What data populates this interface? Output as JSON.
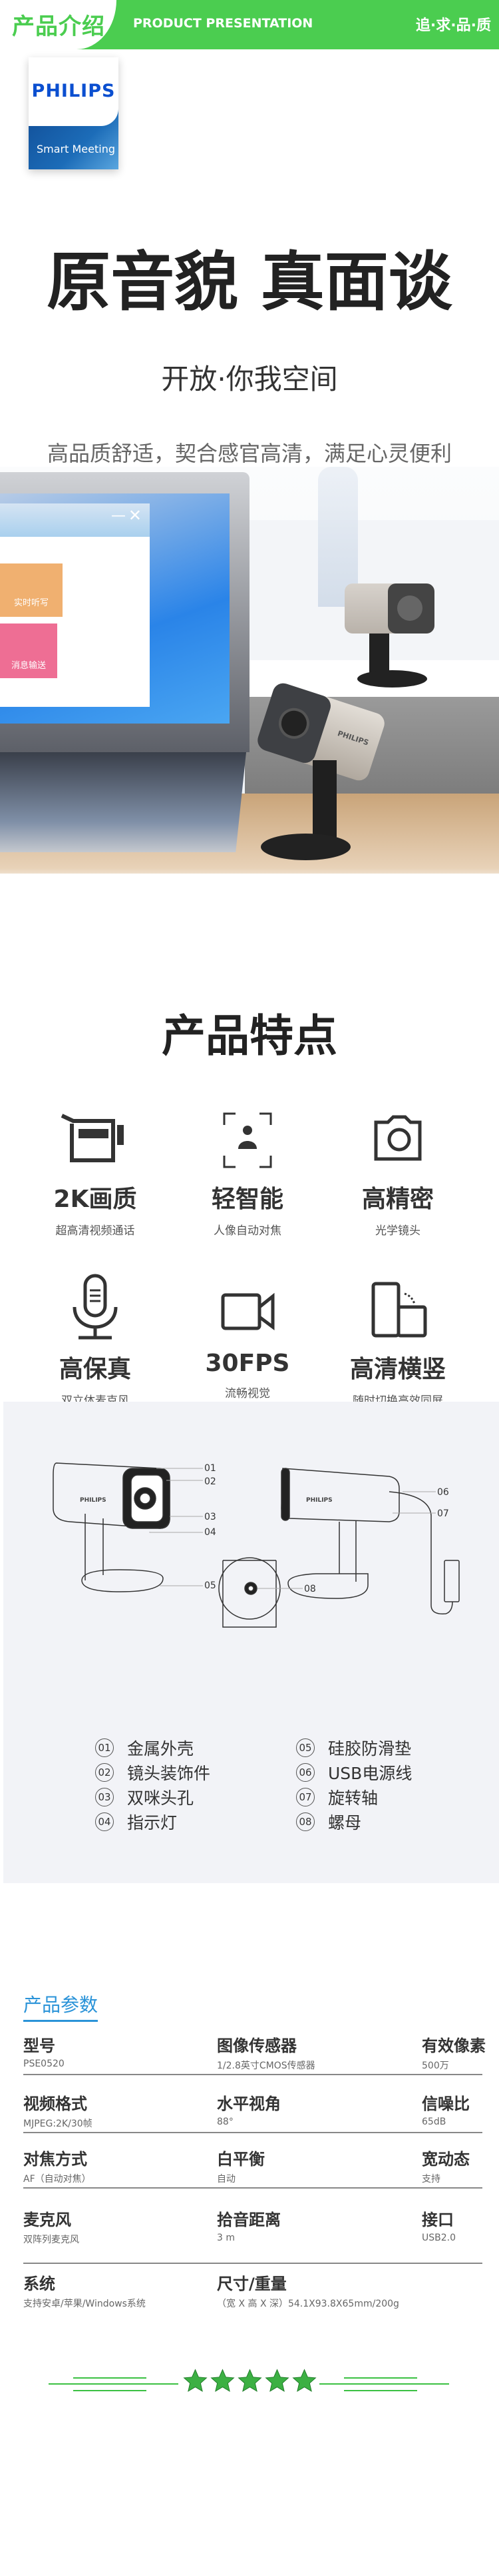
{
  "header": {
    "section": "产品介绍",
    "subtitle": "PRODUCT PRESENTATION",
    "slogan": "追·求·品·质",
    "accent": "#4bcd50"
  },
  "logo": {
    "brand": "PHILIPS",
    "line": "Smart Meeting"
  },
  "hero": {
    "title": "原音貌 真面谈",
    "subtitle": "开放·你我空间",
    "tagline": "高品质舒适，契合感官高清，满足心灵便利"
  },
  "photo": {
    "app_buttons": [
      "实时听写",
      "消息输送"
    ],
    "camera_brand": "PHILIPS"
  },
  "features": {
    "title": "产品特点",
    "items": [
      {
        "icon": "camcorder-icon",
        "label": "2K画质",
        "sub": "超高清视频通话"
      },
      {
        "icon": "face-focus-icon",
        "label": "轻智能",
        "sub": "人像自动对焦"
      },
      {
        "icon": "camera-icon",
        "label": "高精密",
        "sub": "光学镜头"
      },
      {
        "icon": "microphone-icon",
        "label": "高保真",
        "sub": "双立体麦克风"
      },
      {
        "icon": "video-camera-icon",
        "label": "30FPS",
        "sub": "流畅视觉"
      },
      {
        "icon": "phone-rotate-icon",
        "label": "高清横竖",
        "sub": "随时切换高效同屏"
      }
    ]
  },
  "diagram": {
    "brand": "PHILIPS",
    "parts": [
      {
        "n": "01",
        "name": "金属外壳"
      },
      {
        "n": "02",
        "name": "镜头装饰件"
      },
      {
        "n": "03",
        "name": "双咪头孔"
      },
      {
        "n": "04",
        "name": "指示灯"
      },
      {
        "n": "05",
        "name": "硅胶防滑垫"
      },
      {
        "n": "06",
        "name": "USB电源线"
      },
      {
        "n": "07",
        "name": "旋转轴"
      },
      {
        "n": "08",
        "name": "螺母"
      }
    ]
  },
  "specs": {
    "title": "产品参数",
    "rows": [
      [
        {
          "k": "型号",
          "v": "PSE0520"
        },
        {
          "k": "图像传感器",
          "v": "1/2.8英寸CMOS传感器"
        },
        {
          "k": "有效像素",
          "v": "500万"
        }
      ],
      [
        {
          "k": "视频格式",
          "v": "MJPEG:2K/30帧"
        },
        {
          "k": "水平视角",
          "v": "88°"
        },
        {
          "k": "信噪比",
          "v": "65dB"
        }
      ],
      [
        {
          "k": "对焦方式",
          "v": "AF（自动对焦）"
        },
        {
          "k": "白平衡",
          "v": "自动"
        },
        {
          "k": "宽动态",
          "v": "支持"
        }
      ],
      [
        {
          "k": "麦克风",
          "v": "双阵列麦克风"
        },
        {
          "k": "拾音距离",
          "v": "3 m"
        },
        {
          "k": "接口",
          "v": "USB2.0"
        }
      ],
      [
        {
          "k": "系统",
          "v": "支持安卓/苹果/Windows系统"
        },
        {
          "k": "尺寸/重量",
          "v": "（宽 X 高 X 深）54.1X93.8X65mm/200g"
        }
      ]
    ]
  },
  "rating": {
    "stars": 5,
    "star_color": "#3cb043"
  }
}
